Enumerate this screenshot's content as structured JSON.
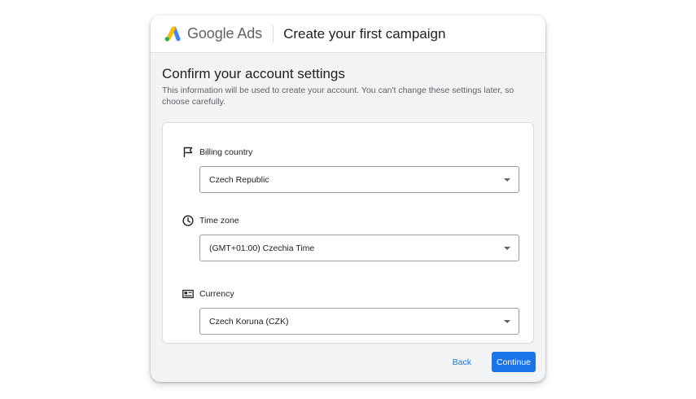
{
  "header": {
    "brand": "Google Ads",
    "title": "Create your first campaign"
  },
  "main": {
    "title": "Confirm your account settings",
    "description": "This information will be used to create your account. You can't change these settings later, so choose carefully."
  },
  "fields": [
    {
      "label": "Billing country",
      "value": "Czech Republic",
      "icon": "flag-icon"
    },
    {
      "label": "Time zone",
      "value": "(GMT+01:00) Czechia Time",
      "icon": "clock-icon"
    },
    {
      "label": "Currency",
      "value": "Czech Koruna (CZK)",
      "icon": "currency-icon"
    }
  ],
  "footer": {
    "back_label": "Back",
    "continue_label": "Continue"
  },
  "colors": {
    "accent": "#1a73e8",
    "logo_blue": "#4285f4",
    "logo_yellow": "#fbbc04",
    "logo_green": "#34a853"
  }
}
